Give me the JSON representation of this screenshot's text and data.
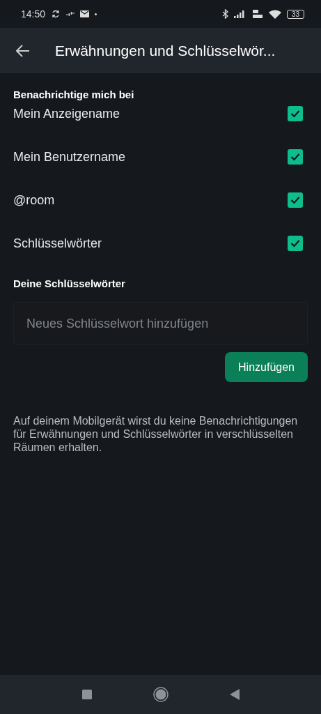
{
  "status_bar": {
    "time": "14:50",
    "battery": "33"
  },
  "app_bar": {
    "title": "Erwähnungen und Schlüsselwör..."
  },
  "notify_section": {
    "heading": "Benachrichtige mich bei",
    "items": [
      {
        "label": "Mein Anzeigename",
        "checked": true
      },
      {
        "label": "Mein Benutzername",
        "checked": true
      },
      {
        "label": "@room",
        "checked": true
      },
      {
        "label": "Schlüsselwörter",
        "checked": true
      }
    ]
  },
  "keywords_section": {
    "heading": "Deine Schlüsselwörter",
    "field": {
      "placeholder": "Neues Schlüsselwort hinzufügen"
    },
    "button": "Hinzufügen"
  },
  "footnote": "Auf deinem Mobilgerät wirst du keine Benachrichtigungen für Erwähnungen und Schlüsselwörter in verschlüsselten Räumen erhalten."
}
